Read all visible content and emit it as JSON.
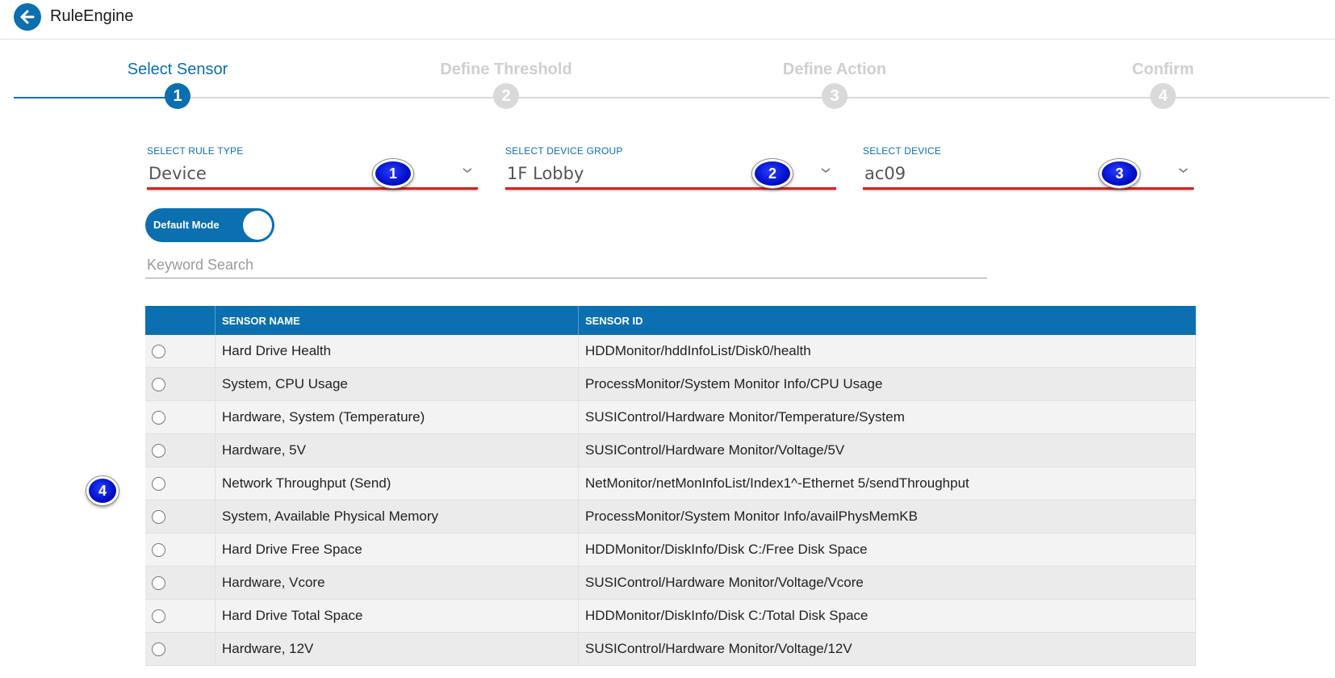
{
  "header": {
    "title": "RuleEngine",
    "back_icon": "arrow-left-icon"
  },
  "stepper": {
    "steps": [
      {
        "label": "Select Sensor",
        "number": "1",
        "active": true
      },
      {
        "label": "Define Threshold",
        "number": "2",
        "active": false
      },
      {
        "label": "Define Action",
        "number": "3",
        "active": false
      },
      {
        "label": "Confirm",
        "number": "4",
        "active": false
      }
    ]
  },
  "selects": {
    "rule_type": {
      "label": "SELECT RULE TYPE",
      "value": "Device"
    },
    "device_group": {
      "label": "SELECT DEVICE GROUP",
      "value": "1F Lobby"
    },
    "device": {
      "label": "SELECT DEVICE",
      "value": "ac09"
    }
  },
  "markers": [
    "1",
    "2",
    "3",
    "4"
  ],
  "toggle": {
    "label": "Default Mode",
    "on": true
  },
  "search": {
    "placeholder": "Keyword Search",
    "value": ""
  },
  "table": {
    "columns": [
      "",
      "SENSOR NAME",
      "SENSOR ID"
    ],
    "rows": [
      {
        "name": "Hard Drive Health",
        "id": "HDDMonitor/hddInfoList/Disk0/health"
      },
      {
        "name": "System, CPU Usage",
        "id": "ProcessMonitor/System Monitor Info/CPU Usage"
      },
      {
        "name": "Hardware, System (Temperature)",
        "id": "SUSIControl/Hardware Monitor/Temperature/System"
      },
      {
        "name": "Hardware, 5V",
        "id": "SUSIControl/Hardware Monitor/Voltage/5V"
      },
      {
        "name": "Network Throughput (Send)",
        "id": "NetMonitor/netMonInfoList/Index1^-Ethernet 5/sendThroughput"
      },
      {
        "name": "System, Available Physical Memory",
        "id": "ProcessMonitor/System Monitor Info/availPhysMemKB"
      },
      {
        "name": "Hard Drive Free Space",
        "id": "HDDMonitor/DiskInfo/Disk C:/Free Disk Space"
      },
      {
        "name": "Hardware, Vcore",
        "id": "SUSIControl/Hardware Monitor/Voltage/Vcore"
      },
      {
        "name": "Hard Drive Total Space",
        "id": "HDDMonitor/DiskInfo/Disk C:/Total Disk Space"
      },
      {
        "name": "Hardware, 12V",
        "id": "SUSIControl/Hardware Monitor/Voltage/12V"
      }
    ]
  },
  "colors": {
    "accent": "#0b6fb0",
    "underline_highlight": "#dd1f1f",
    "marker": "#0010c9"
  }
}
